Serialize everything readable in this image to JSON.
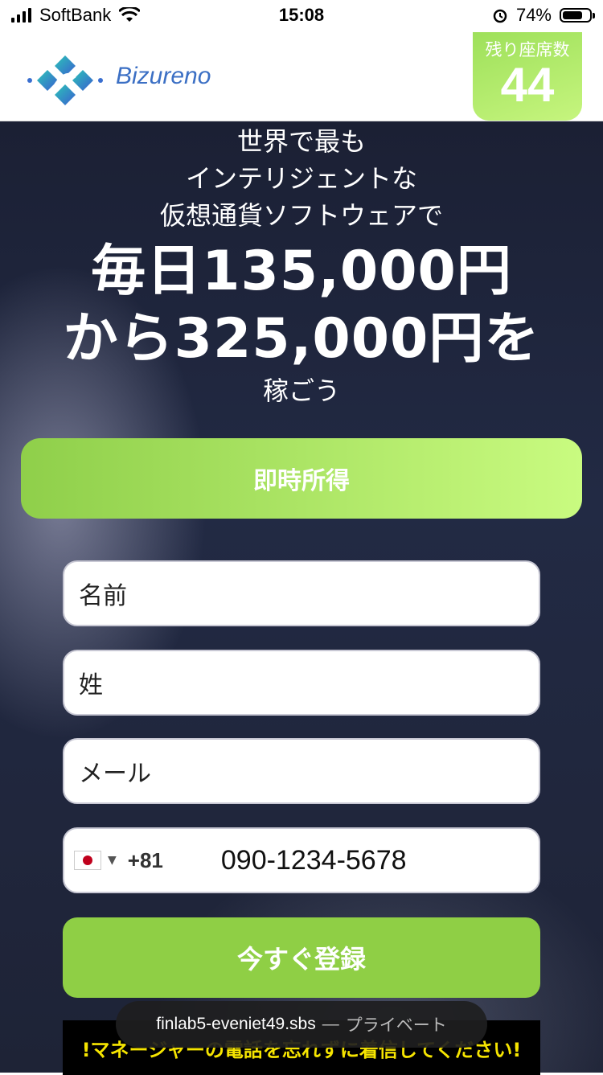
{
  "status_bar": {
    "carrier": "SoftBank",
    "time": "15:08",
    "battery_text": "74%",
    "battery_level": 0.74
  },
  "header": {
    "brand": "Bizureno",
    "seats_label": "残り座席数",
    "seats_count": "44",
    "accent_color": "#a7e764"
  },
  "hero": {
    "line1": "世界で最も",
    "line2": "インテリジェントな",
    "line3": "仮想通貨ソフトウェアで",
    "big1": "毎日135,000円",
    "big2": "から325,000円を",
    "line4": "稼ごう"
  },
  "cta_top_label": "即時所得",
  "form": {
    "first_name_placeholder": "名前",
    "last_name_placeholder": "姓",
    "email_placeholder": "メール",
    "phone_code": "+81",
    "phone_number": "090-1234-5678",
    "submit_label": "今すぐ登録"
  },
  "warning_text": "!マネージャーの電話を忘れずに着信してください!",
  "browser": {
    "url": "finlab5-eveniet49.sbs",
    "separator": "—",
    "mode": "プライベート"
  }
}
